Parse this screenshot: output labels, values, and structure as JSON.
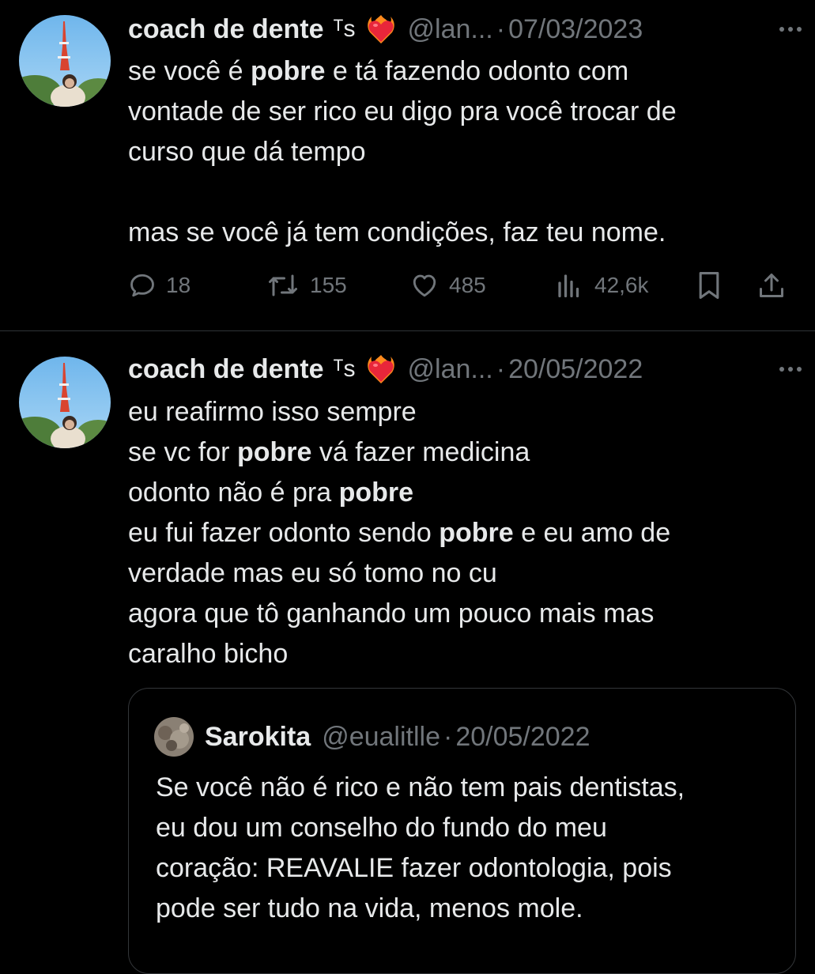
{
  "tweets": [
    {
      "author": "coach de dente",
      "badge": "ᵀs",
      "handle": "@lan...",
      "separator": "·",
      "date": "07/03/2023",
      "text_lines": [
        [
          {
            "t": "se você é "
          },
          {
            "t": "pobre",
            "b": true
          },
          {
            "t": " e tá fazendo odonto com"
          }
        ],
        [
          {
            "t": "vontade de ser rico eu digo pra você trocar de"
          }
        ],
        [
          {
            "t": "curso que dá tempo"
          }
        ],
        [],
        [
          {
            "t": "mas se você já tem condições, faz teu nome."
          }
        ]
      ],
      "stats": {
        "replies": "18",
        "reposts": "155",
        "likes": "485",
        "views": "42,6k"
      }
    },
    {
      "author": "coach de dente",
      "badge": "ᵀs",
      "handle": "@lan...",
      "separator": "·",
      "date": "20/05/2022",
      "text_lines": [
        [
          {
            "t": "eu reafirmo isso sempre"
          }
        ],
        [
          {
            "t": "se vc for "
          },
          {
            "t": "pobre",
            "b": true
          },
          {
            "t": " vá fazer medicina"
          }
        ],
        [
          {
            "t": "odonto não é pra "
          },
          {
            "t": "pobre",
            "b": true
          }
        ],
        [
          {
            "t": "eu fui fazer odonto sendo "
          },
          {
            "t": "pobre",
            "b": true
          },
          {
            "t": " e eu amo de"
          }
        ],
        [
          {
            "t": "verdade mas eu só tomo no cu"
          }
        ],
        [
          {
            "t": "agora que tô ganhando um pouco mais mas"
          }
        ],
        [
          {
            "t": "caralho bicho"
          }
        ]
      ],
      "quoted": {
        "author": "Sarokita",
        "handle": "@eualitlle",
        "separator": "·",
        "date": "20/05/2022",
        "text_lines": [
          "Se você não é rico e não tem pais dentistas,",
          "eu dou um conselho do fundo do meu",
          "coração: REAVALIE fazer odontologia, pois",
          "pode ser tudo na vida, menos mole."
        ]
      }
    }
  ],
  "icons": {
    "more": "more-dots-icon",
    "reply": "reply-bubble-icon",
    "repost": "repost-arrows-icon",
    "like": "heart-outline-icon",
    "views": "bar-chart-icon",
    "bookmark": "bookmark-icon",
    "share": "share-upload-icon",
    "emoji": "heart-on-fire-emoji"
  },
  "colors": {
    "background": "#000000",
    "text": "#e7e9ea",
    "secondary": "#71767b",
    "border": "#2f3336"
  }
}
